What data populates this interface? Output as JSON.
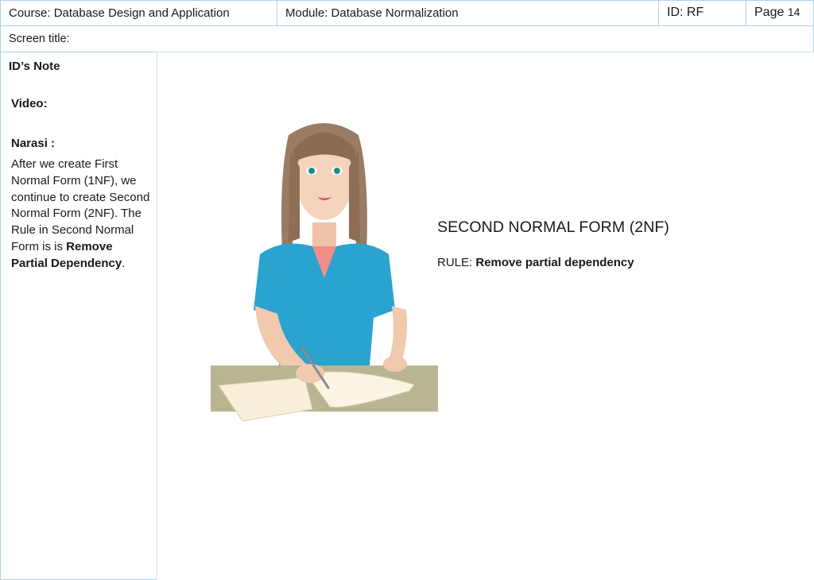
{
  "header": {
    "course": "Course:  Database Design and Application",
    "module": "Module: Database Normalization",
    "id": "ID: RF",
    "page_label": "Page",
    "page_number": "14"
  },
  "screen_title_label": "Screen title:",
  "notes": {
    "heading": "ID’s Note",
    "video_label": "Video:",
    "narration_label": "Narasi :",
    "narration_text": "After we create First Normal Form (1NF), we continue to create Second Normal Form (2NF). The Rule in Second Normal Form is is ",
    "narration_bold": "Remove Partial Dependency",
    "narration_end": "."
  },
  "slide": {
    "title": "SECOND NORMAL FORM (2NF)",
    "rule_label": "RULE: ",
    "rule_text": "Remove partial dependency"
  },
  "illustration": {
    "icon": "woman-writing-at-desk-illustration",
    "colors": {
      "hair": "#9b7b63",
      "shirt": "#2aa3cf",
      "desk": "#b8b592",
      "skin": "#f6d3bd",
      "paper": "#f7efd9"
    }
  },
  "colors": {
    "border": "#a9d3e0",
    "text": "#1a1a1a"
  }
}
